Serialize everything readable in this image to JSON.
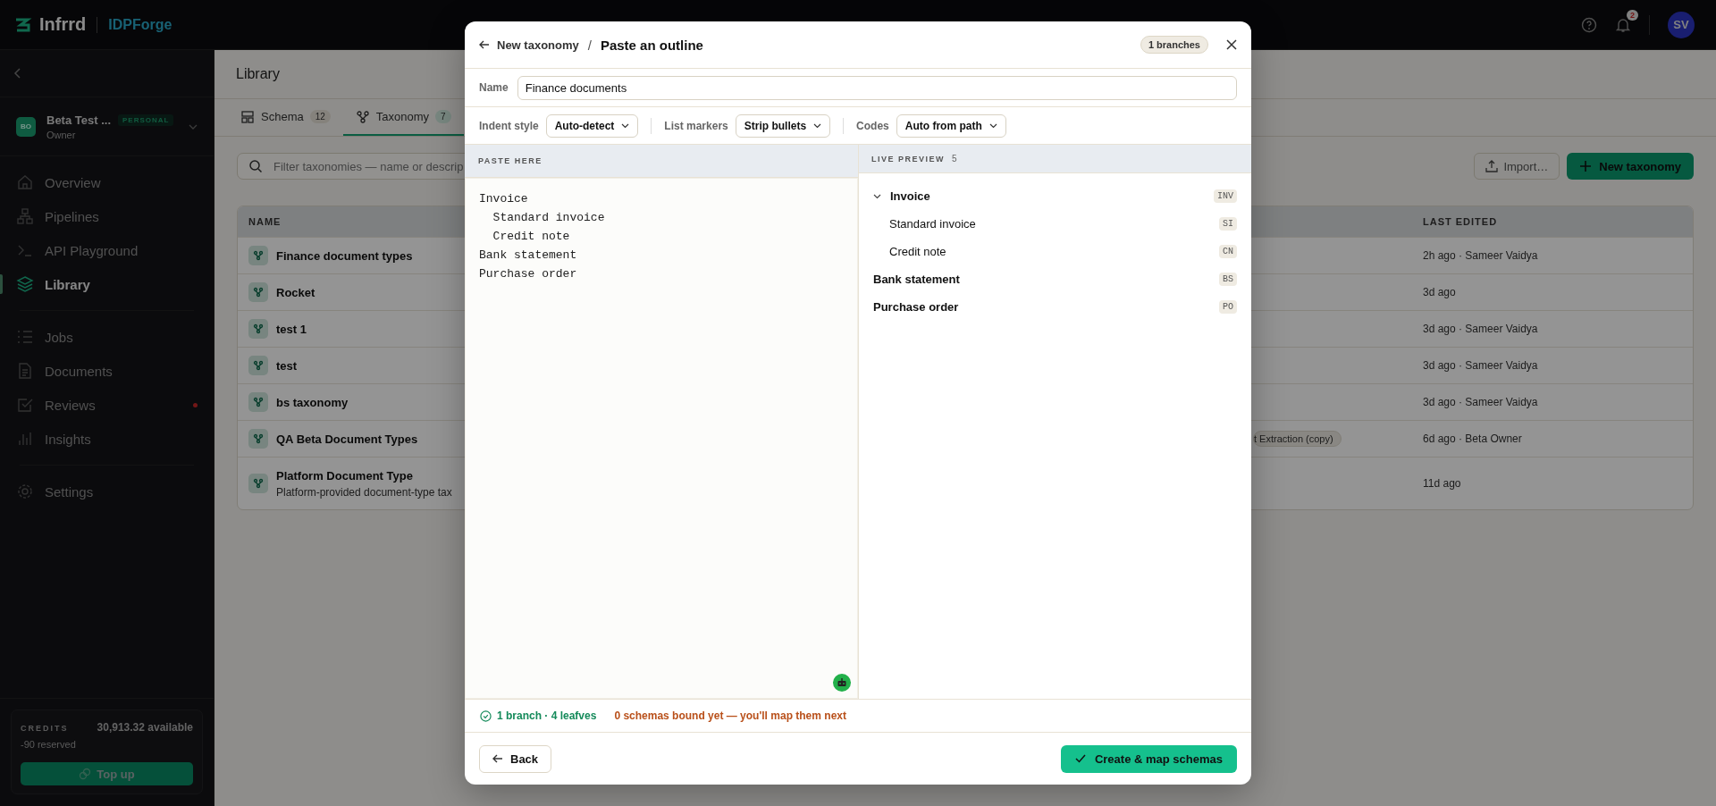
{
  "topbar": {
    "brand": "Infrrd",
    "product": "IDPForge",
    "notification_count": "2",
    "avatar": "SV"
  },
  "sidebar": {
    "account": {
      "initials": "BO",
      "name": "Beta Test ...",
      "badge": "PERSONAL",
      "role": "Owner"
    },
    "groups": [
      [
        {
          "label": "Overview",
          "selected": false,
          "alert": false
        },
        {
          "label": "Pipelines",
          "selected": false,
          "alert": false
        },
        {
          "label": "API Playground",
          "selected": false,
          "alert": false
        },
        {
          "label": "Library",
          "selected": true,
          "alert": false
        }
      ],
      [
        {
          "label": "Jobs",
          "selected": false,
          "alert": false
        },
        {
          "label": "Documents",
          "selected": false,
          "alert": false
        },
        {
          "label": "Reviews",
          "selected": false,
          "alert": true
        },
        {
          "label": "Insights",
          "selected": false,
          "alert": false
        }
      ],
      [
        {
          "label": "Settings",
          "selected": false,
          "alert": false
        }
      ]
    ],
    "credits": {
      "label": "CREDITS",
      "amount": "30,913.32 available",
      "reserved": "-90 reserved",
      "button": "Top up"
    }
  },
  "main": {
    "title": "Library",
    "tabs": [
      {
        "label": "Schema",
        "count": "12",
        "selected": false
      },
      {
        "label": "Taxonomy",
        "count": "7",
        "selected": true
      }
    ],
    "filter": {
      "placeholder": "Filter taxonomies — name or descrip"
    },
    "import_button": "Import…",
    "new_button": "New taxonomy",
    "table": {
      "columns": [
        "NAME",
        "LAST EDITED"
      ],
      "rows": [
        {
          "name": "Finance document types",
          "edited": "2h ago · Sameer Vaidya"
        },
        {
          "name": "Rocket",
          "edited": "3d ago"
        },
        {
          "name": "test 1",
          "edited": "3d ago · Sameer Vaidya"
        },
        {
          "name": "test",
          "edited": "3d ago · Sameer Vaidya"
        },
        {
          "name": "bs taxonomy",
          "edited": "3d ago · Sameer Vaidya"
        },
        {
          "name": "QA Beta Document Types",
          "tag": "t Extraction (copy)",
          "edited": "6d ago · Beta Owner"
        },
        {
          "name": "Platform Document Type",
          "description": "Platform-provided document-type tax",
          "edited": "11d ago"
        }
      ]
    }
  },
  "modal": {
    "back_label": "New taxonomy",
    "separator": "/",
    "title": "Paste an outline",
    "badge": "1 branches",
    "name_label": "Name",
    "name_value": "Finance documents",
    "options": [
      {
        "label": "Indent style",
        "value": "Auto-detect"
      },
      {
        "label": "List markers",
        "value": "Strip bullets"
      },
      {
        "label": "Codes",
        "value": "Auto from path"
      }
    ],
    "paste_heading": "PASTE HERE",
    "paste_value": "Invoice\n  Standard invoice\n  Credit note\nBank statement\nPurchase order",
    "preview_heading": "LIVE PREVIEW",
    "preview_count": "5",
    "tree": [
      {
        "label": "Invoice",
        "code": "INV",
        "expanded": true,
        "children": [
          {
            "label": "Standard invoice",
            "code": "SI"
          },
          {
            "label": "Credit note",
            "code": "CN"
          }
        ]
      },
      {
        "label": "Bank statement",
        "code": "BS"
      },
      {
        "label": "Purchase order",
        "code": "PO"
      }
    ],
    "status_ok": "1 branch · 4 leafves",
    "status_warn": "0 schemas bound yet — you'll map them next",
    "back_button": "Back",
    "create_button": "Create & map schemas"
  }
}
